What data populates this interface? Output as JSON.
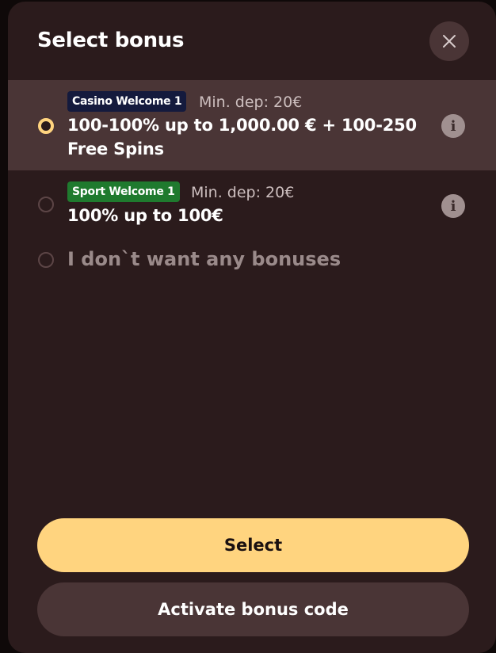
{
  "modal": {
    "title": "Select bonus",
    "close_icon": "close-icon"
  },
  "options": [
    {
      "selected": true,
      "tag": "Casino Welcome 1",
      "tag_color": "#141a3d",
      "min_dep": "Min. dep: 20€",
      "line1": "100-100% up to 1,000.00 € + 100-250",
      "line2": "Free Spins",
      "info_icon": "info-icon"
    },
    {
      "selected": false,
      "tag": "Sport Welcome 1",
      "tag_color": "#1f7a2e",
      "min_dep": "Min. dep: 20€",
      "line1": "100% up to 100€",
      "info_icon": "info-icon"
    },
    {
      "selected": false,
      "label": "I don`t want any bonuses"
    }
  ],
  "buttons": {
    "select": "Select",
    "activate_code": "Activate bonus code"
  },
  "colors": {
    "accent": "#ffd47f",
    "panel": "#2b1b1c",
    "selected_row": "#4a3536"
  }
}
